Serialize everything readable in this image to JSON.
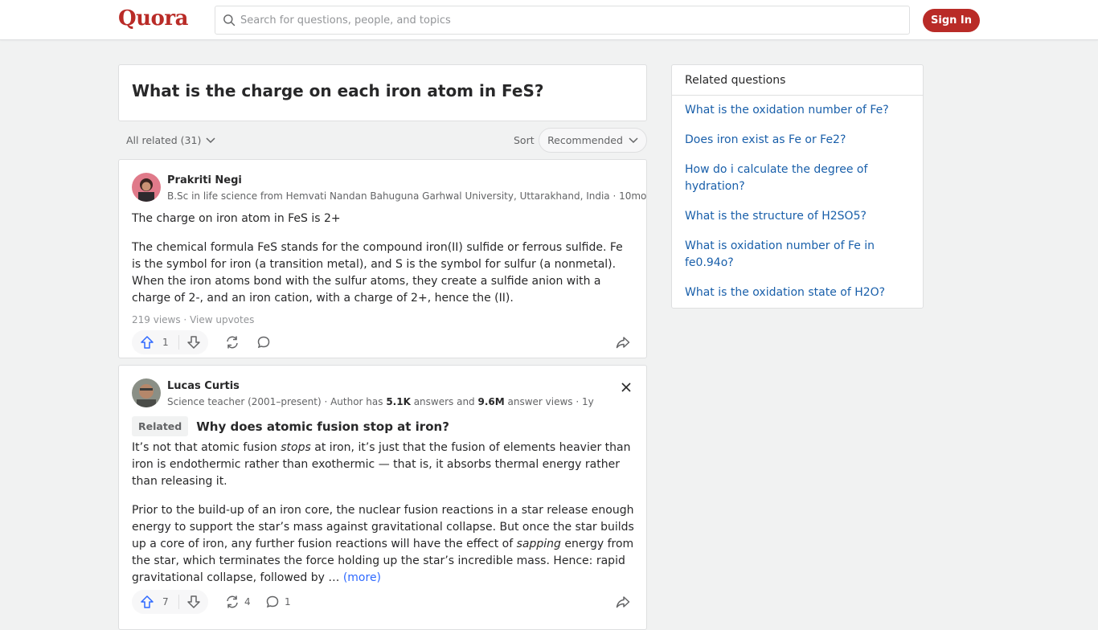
{
  "header": {
    "logo": "Quora",
    "search_placeholder": "Search for questions, people, and topics",
    "signin_label": "Sign In",
    "brand_color": "#b92b27"
  },
  "question": {
    "title": "What is the charge on each iron atom in FeS?"
  },
  "filters": {
    "all_related": "All related (31)",
    "sort_label": "Sort",
    "sort_value": "Recommended"
  },
  "answers": [
    {
      "author": "Prakriti Negi",
      "credential": "B.Sc in life science from Hemvati Nandan Bahuguna Garhwal University, Uttarakhand, India · 10mo",
      "para1": "The charge on iron atom in FeS is 2+",
      "para2": "The chemical formula FeS stands for the compound iron(II) sulfide or ferrous sulfide. Fe is the symbol for iron (a transition metal), and S is the symbol for sulfur (a nonmetal). When the iron atoms bond with the sulfur atoms, they create a sulfide anion with a charge of 2-, and an iron cation, with a charge of 2+, hence the (II).",
      "views": "219 views",
      "view_upvotes": "View upvotes",
      "upvotes": "1"
    },
    {
      "author": "Lucas Curtis",
      "credential_prefix": "Science teacher (2001–present) · Author has ",
      "answers_count": "5.1K",
      "answers_mid": " answers and ",
      "answer_views": "9.6M",
      "credential_suffix": " answer views · 1y",
      "related_tag": "Related",
      "related_title": "Why does atomic fusion stop at iron?",
      "p1_a": "It’s not that atomic fusion ",
      "p1_em": "stops",
      "p1_b": " at iron, it’s just that the fusion of elements heavier than iron is endothermic rather than exothermic — that is, it absorbs thermal energy rather than releasing it.",
      "p2_a": "Prior to the build-up of an iron core, the nuclear fusion reactions in a star release enough energy to support the star’s mass against gravitational collapse. But once the star builds up a core of iron, any further fusion reactions will have the effect of ",
      "p2_em": "sapping",
      "p2_b": " energy from the star, which terminates the force holding up the star’s incredible mass. Hence: rapid gravitational collapse, followed by … ",
      "more": "(more)",
      "upvotes": "7",
      "shares": "4",
      "comments": "1"
    }
  ],
  "sidebar": {
    "heading": "Related questions",
    "questions": [
      "What is the oxidation number of Fe?",
      "Does iron exist as Fe or Fe2?",
      "How do i calculate the degree of hydration?",
      "What is the structure of H2SO5?",
      "What is oxidation number of Fe in fe0.94o?",
      "What is the oxidation state of H2O?"
    ],
    "link_color": "#195faa"
  }
}
